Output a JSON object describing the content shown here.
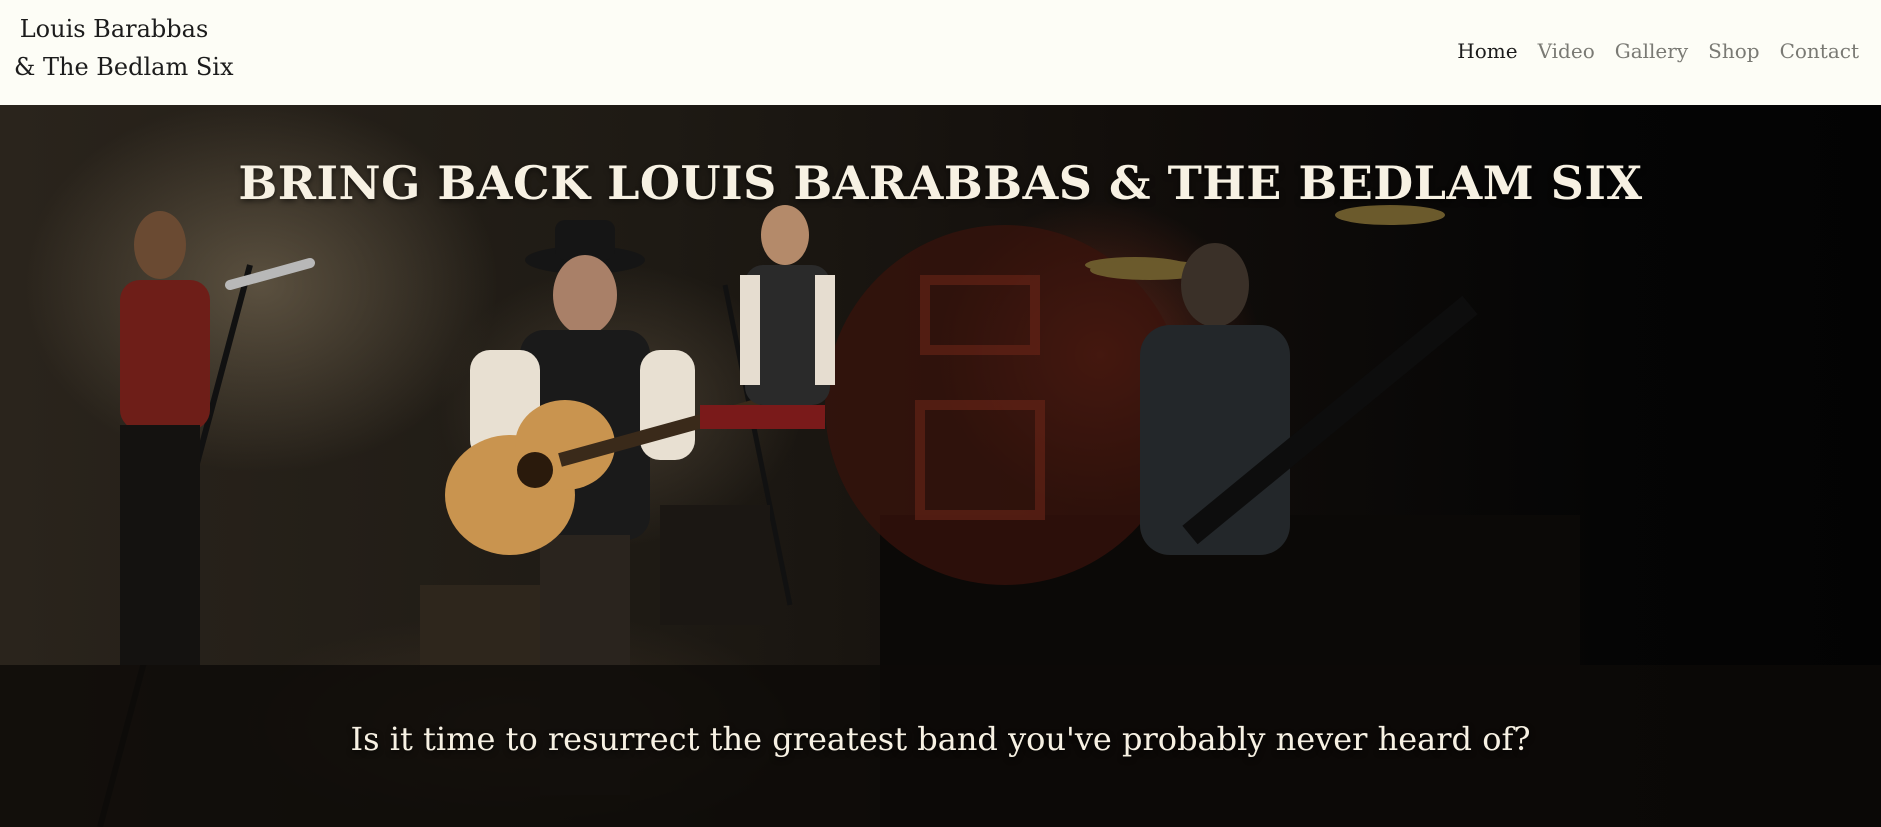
{
  "header": {
    "brand_line1": "Louis Barabbas",
    "brand_line2": "& The Bedlam Six",
    "background": "#fdfdf6"
  },
  "nav": {
    "items": [
      {
        "label": "Home",
        "active": true
      },
      {
        "label": "Video",
        "active": false
      },
      {
        "label": "Gallery",
        "active": false
      },
      {
        "label": "Shop",
        "active": false
      },
      {
        "label": "Contact",
        "active": false
      }
    ],
    "active_color": "#1c1c1c",
    "inactive_color": "#7a7a74"
  },
  "hero": {
    "title": "BRING BACK LOUIS BARABBAS & THE BEDLAM SIX",
    "subtitle": "Is it time to resurrect the greatest band you've probably never heard of?",
    "text_color": "#f7f1e3"
  }
}
